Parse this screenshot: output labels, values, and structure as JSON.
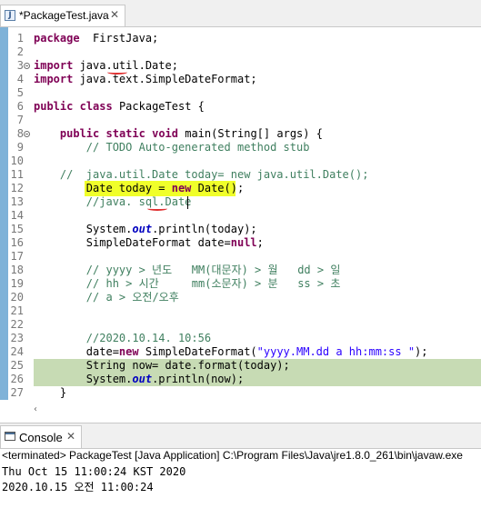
{
  "editor_tab": {
    "title": "*PackageTest.java",
    "icon": "java-file-icon",
    "close": "✕"
  },
  "lines": [
    {
      "n": "1",
      "segs": [
        [
          "kw",
          "package"
        ],
        [
          "",
          "  FirstJava;"
        ]
      ]
    },
    {
      "n": "2",
      "segs": []
    },
    {
      "n": "3",
      "segs": [
        [
          "kw",
          "import"
        ],
        [
          "",
          " java.util.Date;"
        ]
      ]
    },
    {
      "n": "4",
      "segs": [
        [
          "kw",
          "import"
        ],
        [
          "",
          " java.text.SimpleDateFormat;"
        ]
      ]
    },
    {
      "n": "5",
      "segs": []
    },
    {
      "n": "6",
      "segs": [
        [
          "kw",
          "public"
        ],
        [
          "",
          " "
        ],
        [
          "kw",
          "class"
        ],
        [
          "",
          " PackageTest {"
        ]
      ]
    },
    {
      "n": "7",
      "segs": []
    },
    {
      "n": "8",
      "segs": [
        [
          "",
          "    "
        ],
        [
          "kw",
          "public"
        ],
        [
          "",
          " "
        ],
        [
          "kw",
          "static"
        ],
        [
          "",
          " "
        ],
        [
          "kw",
          "void"
        ],
        [
          "",
          " main(String[] args) {"
        ]
      ]
    },
    {
      "n": "9",
      "segs": [
        [
          "",
          "        "
        ],
        [
          "cm",
          "// TODO Auto-generated method stub"
        ]
      ]
    },
    {
      "n": "10",
      "segs": []
    },
    {
      "n": "11",
      "segs": [
        [
          "cm",
          "    //  java.util.Date today= new java.util.Date();"
        ]
      ]
    },
    {
      "n": "12",
      "segs": [
        [
          "",
          "        Date today = "
        ],
        [
          "kw",
          "new"
        ],
        [
          "",
          " Date();"
        ]
      ]
    },
    {
      "n": "13",
      "segs": [
        [
          "",
          "        "
        ],
        [
          "cm",
          "//java. sql.Date"
        ]
      ]
    },
    {
      "n": "14",
      "segs": []
    },
    {
      "n": "15",
      "segs": [
        [
          "",
          "        System."
        ],
        [
          "fld",
          "out"
        ],
        [
          "",
          ".println(today);"
        ]
      ]
    },
    {
      "n": "16",
      "segs": [
        [
          "",
          "        SimpleDateFormat date="
        ],
        [
          "kw",
          "null"
        ],
        [
          "",
          ";"
        ]
      ]
    },
    {
      "n": "17",
      "segs": []
    },
    {
      "n": "18",
      "segs": [
        [
          "",
          "        "
        ],
        [
          "cm",
          "// yyyy > 년도   MM(대문자) > 월   dd > 일"
        ]
      ]
    },
    {
      "n": "19",
      "segs": [
        [
          "",
          "        "
        ],
        [
          "cm",
          "// hh > 시간     mm(소문자) > 분   ss > 초"
        ]
      ]
    },
    {
      "n": "20",
      "segs": [
        [
          "",
          "        "
        ],
        [
          "cm",
          "// a > 오전/오후"
        ]
      ]
    },
    {
      "n": "21",
      "segs": []
    },
    {
      "n": "22",
      "segs": []
    },
    {
      "n": "23",
      "segs": [
        [
          "",
          "        "
        ],
        [
          "cm",
          "//2020.10.14. 10:56"
        ]
      ]
    },
    {
      "n": "24",
      "segs": [
        [
          "",
          "        date="
        ],
        [
          "kw",
          "new"
        ],
        [
          "",
          " SimpleDateFormat("
        ],
        [
          "st",
          "\"yyyy.MM.dd a hh:mm:ss \""
        ],
        [
          "",
          ");"
        ]
      ]
    },
    {
      "n": "25",
      "segs": [
        [
          "",
          "        String now= date.format(today);"
        ]
      ]
    },
    {
      "n": "26",
      "segs": [
        [
          "",
          "        System."
        ],
        [
          "fld",
          "out"
        ],
        [
          "",
          ".println(now);"
        ]
      ]
    },
    {
      "n": "27",
      "segs": [
        [
          "",
          "    }"
        ]
      ]
    }
  ],
  "console": {
    "tab_label": "Console",
    "tab_close": "✕",
    "status": "<terminated> PackageTest [Java Application] C:\\Program Files\\Java\\jre1.8.0_261\\bin\\javaw.exe",
    "output": [
      "Thu Oct 15 11:00:24 KST 2020",
      "2020.10.15 오전 11:00:24"
    ]
  },
  "colors": {
    "keyword": "#7f0055",
    "comment": "#3f7f5f",
    "string": "#2a00ff",
    "highlight_yellow": "#f0ff2a",
    "selection_green": "#c7dbb4"
  }
}
